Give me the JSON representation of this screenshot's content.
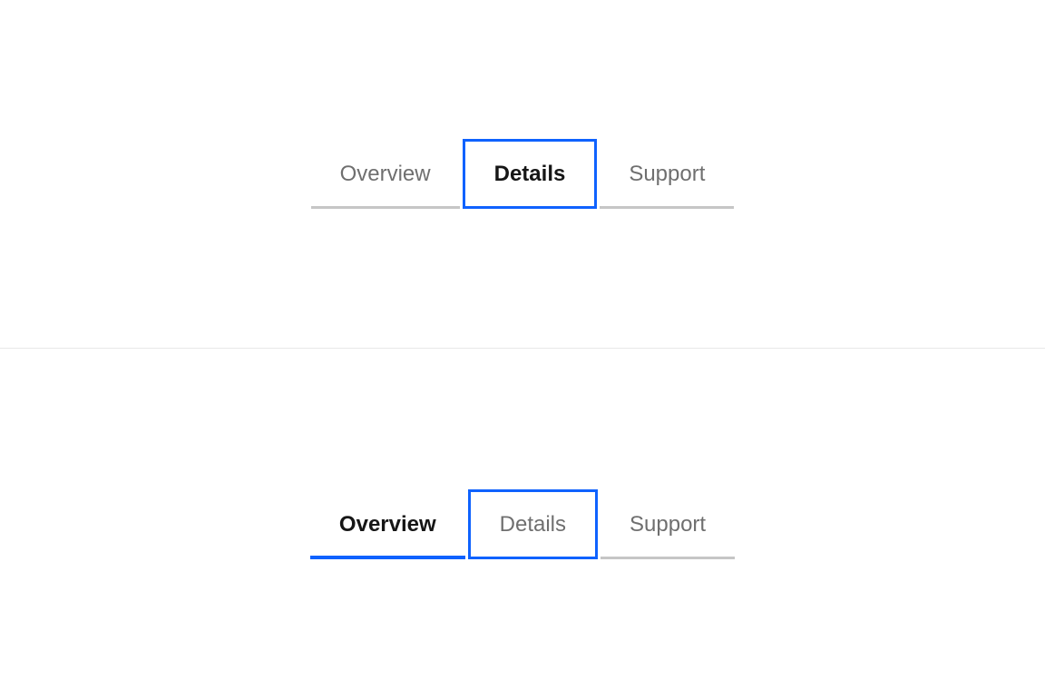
{
  "example_a": {
    "tabs": [
      {
        "label": "Overview"
      },
      {
        "label": "Details"
      },
      {
        "label": "Support"
      }
    ]
  },
  "example_b": {
    "tabs": [
      {
        "label": "Overview"
      },
      {
        "label": "Details"
      },
      {
        "label": "Support"
      }
    ]
  }
}
